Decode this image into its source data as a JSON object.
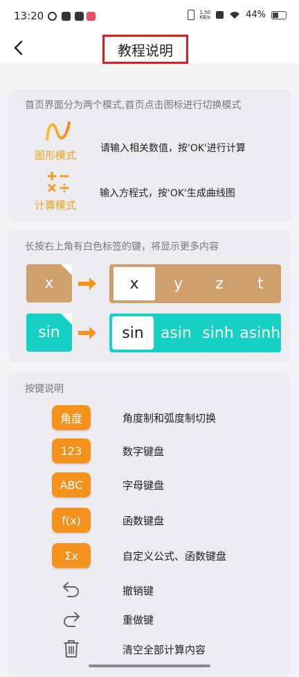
{
  "status_bar": {
    "time": "13:20",
    "speed_top": "1.50",
    "speed_bottom": "KB/s",
    "battery": "44%"
  },
  "header": {
    "back_icon": "arrow-left-icon",
    "title": "教程说明"
  },
  "modes_card": {
    "title": "首页界面分为两个模式,首页点击图标进行切换模式",
    "modes": [
      {
        "icon": "graph-wave-icon",
        "label": "图形模式",
        "description": "请输入相关数值，按'OK'进行计算"
      },
      {
        "icon": "calculator-ops-icon",
        "label": "计算模式",
        "description": "输入方程式，按'OK'生成曲线图"
      }
    ]
  },
  "longpress_card": {
    "title": "长按右上角有白色标签的键，将显示更多内容",
    "examples": [
      {
        "key": "x",
        "options": [
          "x",
          "y",
          "z",
          "t"
        ],
        "color": "#cf9f6e"
      },
      {
        "key": "sin",
        "options": [
          "sin",
          "asin",
          "sinh",
          "asinh"
        ],
        "color": "#16d0c4"
      }
    ]
  },
  "keys_card": {
    "title": "按键说明",
    "keys": [
      {
        "label": "角度",
        "description": "角度制和弧度制切换"
      },
      {
        "label": "123",
        "description": "数字键盘"
      },
      {
        "label": "ABC",
        "description": "字母键盘"
      },
      {
        "label": "f(x)",
        "description": "函数键盘"
      },
      {
        "label": "Σx",
        "description": "自定义公式、函数键盘"
      },
      {
        "icon": "undo-icon",
        "description": "撤销键"
      },
      {
        "icon": "redo-icon",
        "description": "重做键"
      },
      {
        "icon": "trash-icon",
        "description": "清空全部计算内容"
      }
    ]
  },
  "colors": {
    "accent_orange": "#f5931e",
    "highlight_red": "#d62020"
  }
}
